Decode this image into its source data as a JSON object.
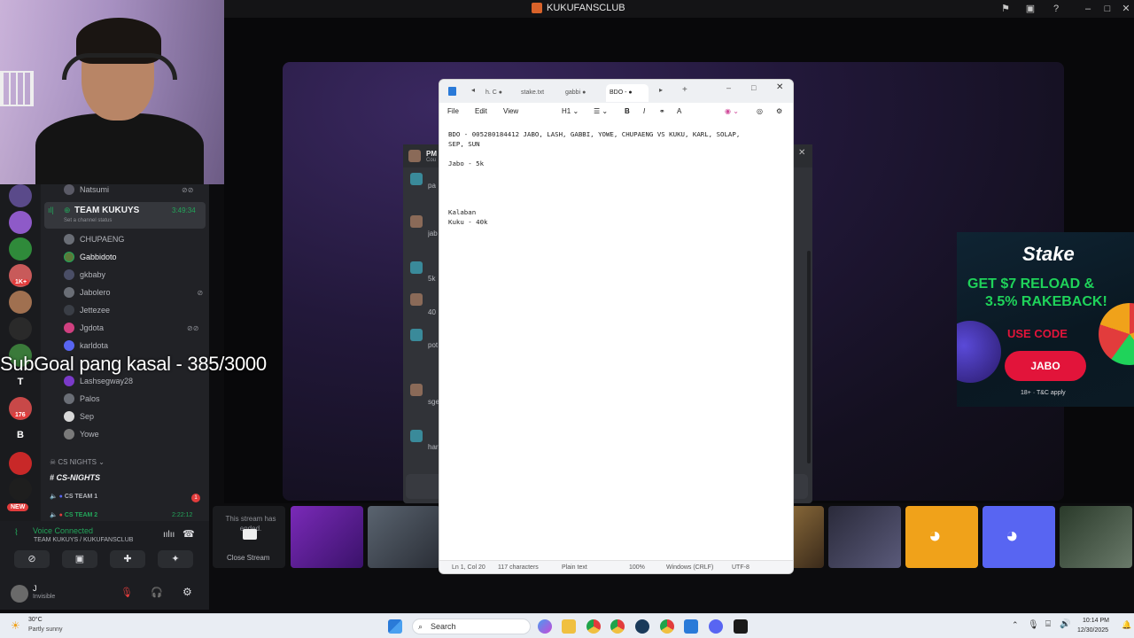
{
  "window": {
    "title": "KUKUFANSCLUB"
  },
  "overlay": {
    "subgoal": "SubGoal pang kasal - 385/3000"
  },
  "server_rail": {
    "badges": [
      "1K+",
      "176"
    ],
    "letters": [
      "T",
      "B"
    ],
    "new_label": "NEW"
  },
  "channels": {
    "top_user": "Natsumi",
    "voice_channel": {
      "name": "TEAM KUKUYS",
      "timer": "3:49:34",
      "status": "Set a channel status"
    },
    "members": [
      "CHUPAENG",
      "Gabbidoto",
      "gkbaby",
      "Jabolero",
      "Jettezee",
      "Jgdota",
      "karldota",
      "Lashsegway28",
      "Palos",
      "Sep",
      "Yowe"
    ],
    "category": "CS NIGHTS",
    "text_channel": "CS-NIGHTS",
    "cs_team_1": "CS TEAM 1",
    "cs_team_1_badge": "1",
    "cs_team_2": "CS TEAM 2",
    "cs_team_2_timer": "2:22:12"
  },
  "voice_bar": {
    "status": "Voice Connected",
    "location": "TEAM KUKUYS / KUKUFANSCLUB",
    "user_name": "J",
    "user_status": "Invisible"
  },
  "chat": {
    "header": "PM",
    "header_sub": "Cou",
    "snippets": [
      "pa",
      "jab sm",
      "5k",
      "40",
      "pot ge per",
      "sge g",
      "har"
    ]
  },
  "stream_strip": {
    "ended_text": "This stream has ended.",
    "close_label": "Close Stream"
  },
  "notepad": {
    "tabs": [
      "h. C",
      "stake.txt",
      "gabbi",
      "BDO -"
    ],
    "menu": {
      "file": "File",
      "edit": "Edit",
      "view": "View",
      "heading": "H1"
    },
    "content": "BDO - 005280184412 JABO, LASH, GABBI, YOWE, CHUPAENG VS KUKU, KARL, SOLAP,\nSEP, SUN\n\nJabo - 5k\n\n\n\n\nKalaban\nKuku - 40k",
    "status": {
      "position": "Ln 1, Col 20",
      "chars": "117 characters",
      "format": "Plain text",
      "zoom": "100%",
      "line_ending": "Windows (CRLF)",
      "encoding": "UTF-8"
    }
  },
  "stake_ad": {
    "brand": "Stake",
    "headline_1": "GET $7 RELOAD &",
    "headline_2": "3.5% RAKEBACK!",
    "use_code": "USE CODE",
    "code": "JABO",
    "fine_print": "18+ · T&C apply"
  },
  "taskbar": {
    "weather_temp": "30°C",
    "weather_desc": "Partly sunny",
    "search_label": "Search",
    "time": "10:14 PM",
    "date": "12/30/2025"
  },
  "colors": {
    "discord_bg": "#212226",
    "accent_green": "#23a55a",
    "stake_green": "#1fd35a",
    "stake_red": "#e2143a"
  }
}
